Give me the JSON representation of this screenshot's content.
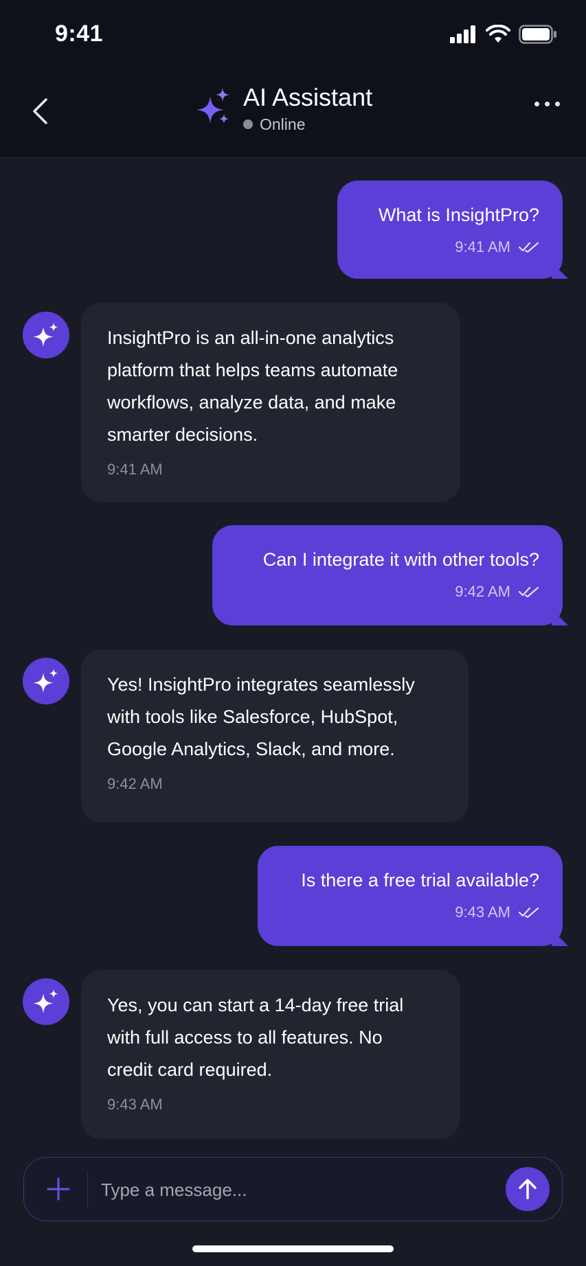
{
  "status_bar": {
    "time": "9:41"
  },
  "header": {
    "title": "AI Assistant",
    "status": "Online"
  },
  "messages": [
    {
      "sender": "user",
      "text": "What is InsightPro?",
      "time": "9:41 AM"
    },
    {
      "sender": "assistant",
      "lines": [
        "InsightPro is an all-in-one analytics",
        "platform that helps teams automate",
        "workflows, analyze data, and make",
        "smarter decisions."
      ],
      "time": "9:41 AM"
    },
    {
      "sender": "user",
      "text": "Can I integrate it with other tools?",
      "time": "9:42 AM"
    },
    {
      "sender": "assistant",
      "lines": [
        "Yes! InsightPro integrates seamlessly",
        "with tools like Salesforce, HubSpot,",
        "Google Analytics, Slack, and more."
      ],
      "time": "9:42 AM"
    },
    {
      "sender": "user",
      "text": "Is there a free trial available?",
      "time": "9:43 AM"
    },
    {
      "sender": "assistant",
      "lines": [
        "Yes, you can start a 14-day free trial",
        "with full access to all features. No",
        "credit card required."
      ],
      "time": "9:43 AM"
    }
  ],
  "composer": {
    "placeholder": "Type a message..."
  },
  "icons": {
    "back": "chevron-left-icon",
    "brand": "sparkles-icon",
    "more": "more-horizontal-icon",
    "read_receipt": "double-check-icon",
    "attach": "plus-icon",
    "send": "arrow-up-icon"
  },
  "colors": {
    "accent": "#5b3fd6",
    "background": "#181a26",
    "assistant_bubble": "#22242f"
  }
}
